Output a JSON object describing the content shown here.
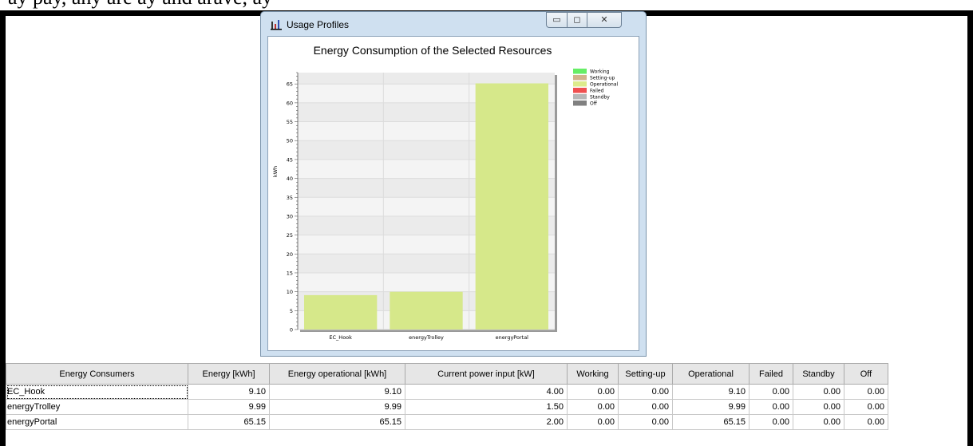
{
  "top_caption": "ay pay, any are ay and arave, ay",
  "window": {
    "title": "Usage Profiles",
    "icon": "bar-chart-app-icon",
    "controls": {
      "minimize": "▭",
      "maximize": "◻",
      "close": "✕"
    }
  },
  "chart_data": {
    "type": "bar",
    "title": "Energy Consumption of the Selected Resources",
    "ylabel": "kWh",
    "xlabel": "",
    "ylim": [
      0,
      68
    ],
    "yticks": [
      0,
      5,
      10,
      15,
      20,
      25,
      30,
      35,
      40,
      45,
      50,
      55,
      60,
      65
    ],
    "categories": [
      "EC_Hook",
      "energyTrolley",
      "energyPortal"
    ],
    "series": [
      {
        "name": "Operational",
        "color": "#d6e88a",
        "values": [
          9.1,
          9.99,
          65.15
        ]
      }
    ],
    "legend": [
      {
        "label": "Working",
        "color": "#66ee66"
      },
      {
        "label": "Setting-up",
        "color": "#d2b48c"
      },
      {
        "label": "Operational",
        "color": "#ddeb8c"
      },
      {
        "label": "Failed",
        "color": "#f05050"
      },
      {
        "label": "Standby",
        "color": "#b8b8b8"
      },
      {
        "label": "Off",
        "color": "#808080"
      }
    ],
    "legend_position": "top-right",
    "grid": true
  },
  "table": {
    "columns": [
      "Energy Consumers",
      "Energy [kWh]",
      "Energy operational [kWh]",
      "Current power input [kW]",
      "Working",
      "Setting-up",
      "Operational",
      "Failed",
      "Standby",
      "Off"
    ],
    "rows": [
      [
        "EC_Hook",
        "9.10",
        "9.10",
        "4.00",
        "0.00",
        "0.00",
        "9.10",
        "0.00",
        "0.00",
        "0.00"
      ],
      [
        "energyTrolley",
        "9.99",
        "9.99",
        "1.50",
        "0.00",
        "0.00",
        "9.99",
        "0.00",
        "0.00",
        "0.00"
      ],
      [
        "energyPortal",
        "65.15",
        "65.15",
        "2.00",
        "0.00",
        "0.00",
        "65.15",
        "0.00",
        "0.00",
        "0.00"
      ]
    ]
  }
}
